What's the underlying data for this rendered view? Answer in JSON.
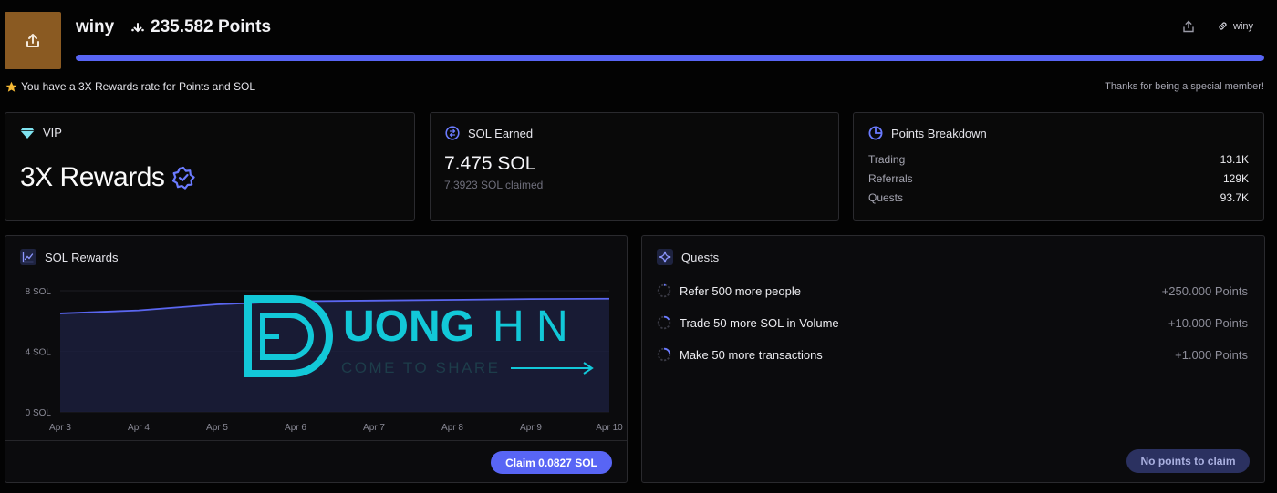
{
  "header": {
    "username": "winy",
    "points_text": "235.582 Points",
    "progress_fraction": 1.0,
    "link_label": "winy"
  },
  "info": {
    "rate_note": "You have a 3X Rewards rate for Points and SOL",
    "thanks_note": "Thanks for being a special member!"
  },
  "vip": {
    "title": "VIP",
    "headline": "3X Rewards"
  },
  "sol_earned": {
    "title": "SOL Earned",
    "value": "7.475 SOL",
    "claimed": "7.3923 SOL claimed"
  },
  "points_breakdown": {
    "title": "Points Breakdown",
    "rows": [
      {
        "label": "Trading",
        "value": "13.1K"
      },
      {
        "label": "Referrals",
        "value": "129K"
      },
      {
        "label": "Quests",
        "value": "93.7K"
      }
    ]
  },
  "sol_rewards": {
    "title": "SOL Rewards",
    "claim_label": "Claim 0.0827 SOL"
  },
  "chart_data": {
    "type": "area",
    "title": "",
    "xlabel": "",
    "ylabel": "",
    "x": [
      "Apr 3",
      "Apr 4",
      "Apr 5",
      "Apr 6",
      "Apr 7",
      "Apr 8",
      "Apr 9",
      "Apr 10"
    ],
    "series": [
      {
        "values": [
          6.5,
          6.7,
          7.1,
          7.3,
          7.35,
          7.4,
          7.45,
          7.475
        ]
      }
    ],
    "y_ticks": [
      "0 SOL",
      "4 SOL",
      "8 SOL"
    ],
    "y_tick_values": [
      0,
      4,
      8
    ],
    "ylim": [
      0,
      8
    ],
    "grid": true,
    "line_color": "#5a66f0",
    "fill_color": "#1b1e3c"
  },
  "watermark": {
    "brand_word": "UONG",
    "brand_word2": "H N",
    "tagline": "COME TO SHARE",
    "color": "#12c8d8"
  },
  "quests": {
    "title": "Quests",
    "items": [
      {
        "label": "Refer 500 more people",
        "reward": "+250.000 Points"
      },
      {
        "label": "Trade 50 more SOL in Volume",
        "reward": "+10.000 Points"
      },
      {
        "label": "Make 50 more transactions",
        "reward": "+1.000 Points"
      }
    ],
    "no_claim_label": "No points to claim"
  },
  "colors": {
    "accent": "#5865f5",
    "avatar": "#8a5a22",
    "star": "#f5b935"
  },
  "icons": {
    "avatar": "upload-icon",
    "points": "sparkle-down-icon",
    "vip": "diamond-icon",
    "badge": "verified-badge-icon",
    "sol": "coin-swap-icon",
    "breakdown": "pie-chart-icon",
    "rewards": "line-chart-icon",
    "quests": "sparkle-icon"
  }
}
